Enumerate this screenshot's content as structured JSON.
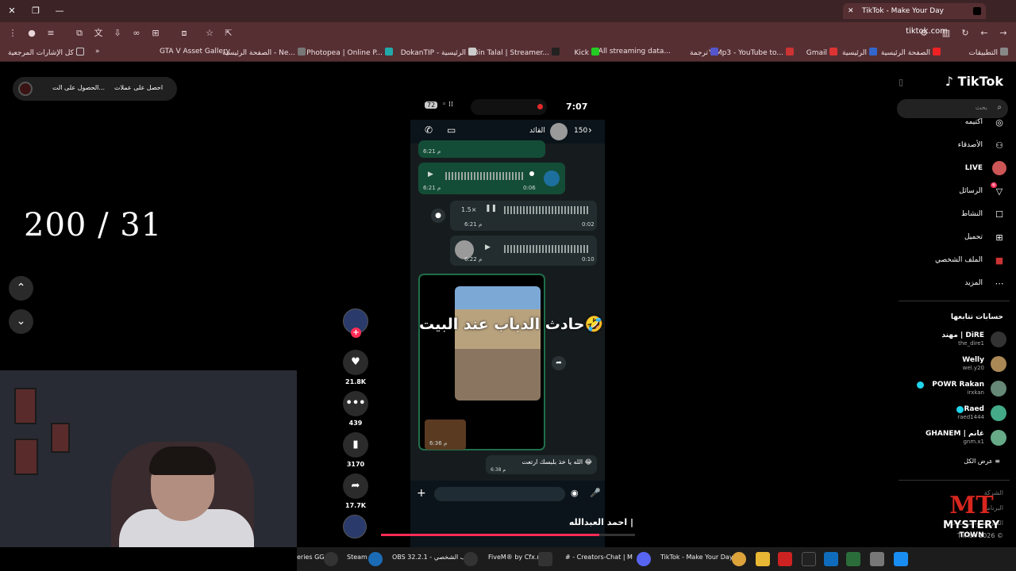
{
  "browser": {
    "tab_title": "TikTok - Make Your Day",
    "url": "tiktok.com",
    "bookmarks": [
      "التطبيقات",
      "الصفحة الرئيسية",
      "الرئيسية",
      "Gmail",
      "YtMp3 - YouTube to...",
      "ترجمة",
      "All streaming data...",
      "Kick",
      "Bin Talal | Streamer...",
      "DokanTIP - الرئيسية",
      "Photopea | Online P...",
      "الصفحة الرئيسية - Ne...",
      "GTA V Asset Gallery",
      "كل الإشارات المرجعية"
    ]
  },
  "stream_overlay": {
    "counter": "200 / 31",
    "pill_label_1": "احصل على عملات",
    "pill_label_2": "الحصول على الت..."
  },
  "phone": {
    "time": "7:07",
    "battery": "72",
    "contact_name": "القائد",
    "back_count": "150",
    "messages": [
      {
        "time": "6:21 م"
      },
      {
        "duration": "0:06",
        "time": "6:21 م"
      },
      {
        "speed": "1.5×",
        "duration": "0:02",
        "time": "6:21 م"
      },
      {
        "duration": "0:10",
        "time": "6:22 م"
      },
      {
        "time": "6:36 م"
      },
      {
        "text": "الله يا خذ بلبسك ارتعت 😂",
        "time": "6:38 م"
      }
    ]
  },
  "video": {
    "overlay_text": "حادث الدباب عند البيت🤣",
    "caption": "احمد العبدالله |",
    "progress": 0.86
  },
  "actions": {
    "likes": "21.8K",
    "comments": "439",
    "saves": "3170",
    "shares": "17.7K"
  },
  "tiktok": {
    "logo": "TikTok",
    "search_placeholder": "بحث",
    "menu": [
      {
        "label": "اكتيمه",
        "icon": "explore-icon"
      },
      {
        "label": "الأصدقاء",
        "icon": "friends-icon"
      },
      {
        "label": "LIVE",
        "icon": "live-icon"
      },
      {
        "label": "الرسائل",
        "icon": "messages-icon",
        "badge": "6"
      },
      {
        "label": "النشاط",
        "icon": "activity-icon"
      },
      {
        "label": "تحميل",
        "icon": "upload-icon"
      },
      {
        "label": "الملف الشخصي",
        "icon": "profile-icon"
      },
      {
        "label": "المزيد",
        "icon": "more-icon"
      }
    ],
    "following_header": "حسابات تتابعها",
    "following": [
      {
        "name": "مهند | DiRE",
        "handle": "the_dire1"
      },
      {
        "name": "Welly",
        "handle": "wel.y20"
      },
      {
        "name": "POWR Rakan",
        "handle": "irxkan"
      },
      {
        "name": "Raed",
        "handle": "raed1444"
      },
      {
        "name": "GHANEM | غانم",
        "handle": "gnm.x1"
      }
    ],
    "see_all": "عرض الكل",
    "footer_1": "الشركة",
    "footer_2": "البرنامج",
    "footer_3": "الشروط والسياسات",
    "copyright": "TikTok 2026 ©"
  },
  "taskbar": {
    "items": [
      "eries GG",
      "Steam",
      "OBS 32.2.1 - الملف الشخصي",
      "FiveM® by Cfx.re",
      "# - Creators-Chat | M",
      "TikTok - Make Your Day"
    ]
  },
  "watermark": {
    "mys": "MYSTERY",
    "town": "TOWN"
  }
}
